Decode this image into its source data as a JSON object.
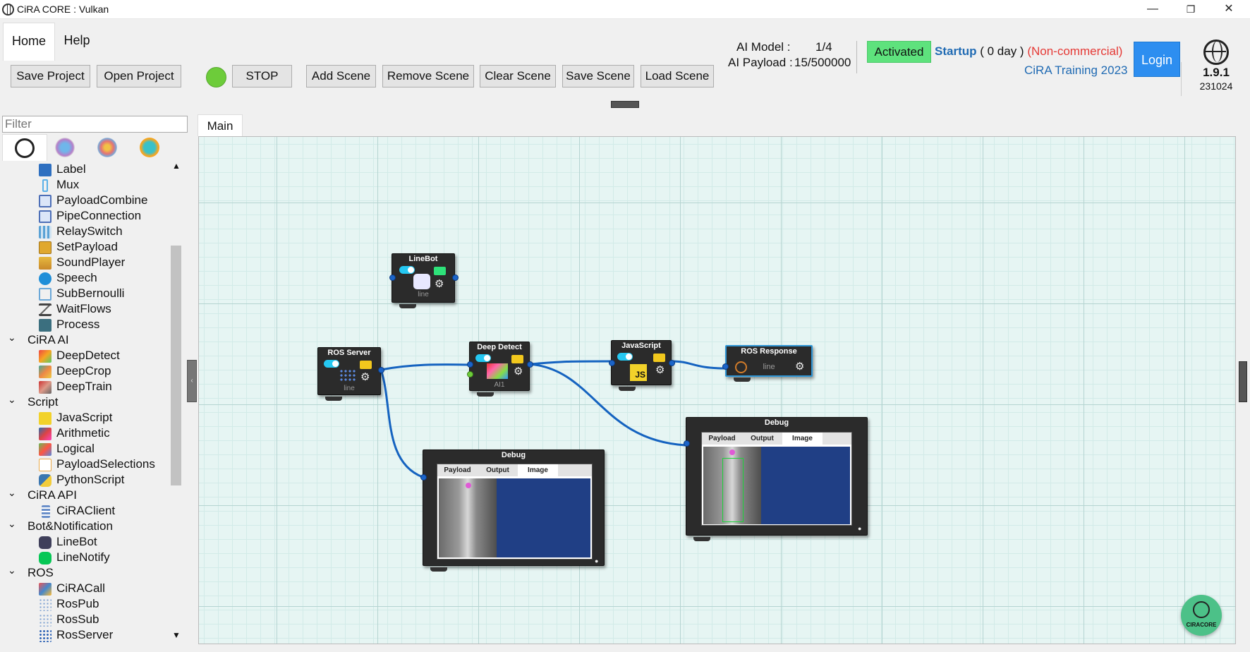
{
  "window": {
    "title": "CiRA CORE : Vulkan",
    "minimize": "—",
    "restore": "❐",
    "close": "✕"
  },
  "menu": {
    "home": "Home",
    "help": "Help"
  },
  "status": {
    "ai_model_label": "AI Model :",
    "ai_model_value": "1/4",
    "ai_payload_label": "AI Payload :",
    "ai_payload_value": "15/500000",
    "activated": "Activated",
    "startup": "Startup",
    "days": "( 0 day )",
    "license": "(Non-commercial)",
    "training": "CiRA Training 2023",
    "login": "Login",
    "version": "1.9.1",
    "build": "231024"
  },
  "toolbar": {
    "save_project": "Save Project",
    "open_project": "Open Project",
    "stop": "STOP",
    "add_scene": "Add Scene",
    "remove_scene": "Remove Scene",
    "clear_scene": "Clear Scene",
    "save_scene": "Save Scene",
    "load_scene": "Load Scene",
    "run_indicator_color": "#6dcc3a"
  },
  "sidebar": {
    "filter_placeholder": "Filter",
    "category_icons": [
      "globe-icon",
      "network-icon",
      "robot-icon",
      "book-icon"
    ],
    "items": [
      {
        "label": "Label",
        "icon": "label-icon"
      },
      {
        "label": "Mux",
        "icon": "mux-icon"
      },
      {
        "label": "PayloadCombine",
        "icon": "combine-icon"
      },
      {
        "label": "PipeConnection",
        "icon": "pipe-icon"
      },
      {
        "label": "RelaySwitch",
        "icon": "relay-icon"
      },
      {
        "label": "SetPayload",
        "icon": "box-icon"
      },
      {
        "label": "SoundPlayer",
        "icon": "sound-icon"
      },
      {
        "label": "Speech",
        "icon": "speech-icon"
      },
      {
        "label": "SubBernoulli",
        "icon": "bernoulli-icon"
      },
      {
        "label": "WaitFlows",
        "icon": "hourglass-icon"
      },
      {
        "label": "Process",
        "icon": "terminal-icon"
      }
    ],
    "group_cira_ai": "CiRA AI",
    "items_ai": [
      {
        "label": "DeepDetect",
        "icon": "deepdetect-icon"
      },
      {
        "label": "DeepCrop",
        "icon": "deepcrop-icon"
      },
      {
        "label": "DeepTrain",
        "icon": "deeptrain-icon"
      }
    ],
    "group_script": "Script",
    "items_script": [
      {
        "label": "JavaScript",
        "icon": "js-icon"
      },
      {
        "label": "Arithmetic",
        "icon": "arithmetic-icon"
      },
      {
        "label": "Logical",
        "icon": "logical-icon"
      },
      {
        "label": "PayloadSelections",
        "icon": "selection-icon"
      },
      {
        "label": "PythonScript",
        "icon": "python-icon"
      }
    ],
    "group_api": "CiRA API",
    "items_api": [
      {
        "label": "CiRAClient",
        "icon": "client-icon"
      }
    ],
    "group_bot": "Bot&Notification",
    "items_bot": [
      {
        "label": "LineBot",
        "icon": "linebot-icon"
      },
      {
        "label": "LineNotify",
        "icon": "line-icon"
      }
    ],
    "group_ros": "ROS",
    "items_ros": [
      {
        "label": "CiRACall",
        "icon": "ciracall-icon"
      },
      {
        "label": "RosPub",
        "icon": "rospub-icon"
      },
      {
        "label": "RosSub",
        "icon": "rossub-icon"
      },
      {
        "label": "RosServer",
        "icon": "rosserver-icon"
      }
    ]
  },
  "scene": {
    "tab": "Main",
    "nodes": {
      "linebot": {
        "title": "LineBot",
        "sub": "line"
      },
      "ros_server": {
        "title": "ROS Server",
        "sub": "line"
      },
      "deep_detect": {
        "title": "Deep Detect",
        "sub": "AI1"
      },
      "javascript": {
        "title": "JavaScript",
        "badge": "JS"
      },
      "ros_response": {
        "title": "ROS Response",
        "sub": "line"
      },
      "debug1": {
        "title": "Debug",
        "tabs": [
          "Payload",
          "Output",
          "Image"
        ]
      },
      "debug2": {
        "title": "Debug",
        "tabs": [
          "Payload",
          "Output",
          "Image"
        ]
      }
    }
  },
  "fab": {
    "label": "CIRACORE"
  }
}
